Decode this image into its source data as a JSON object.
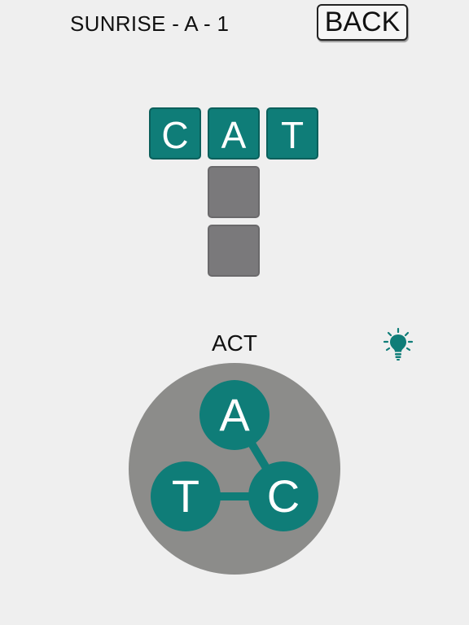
{
  "header": {
    "level_title": "SUNRISE - A - 1",
    "back_label": "BACK"
  },
  "grid": {
    "cells": [
      {
        "row": 0,
        "col": 0,
        "letter": "C",
        "state": "filled"
      },
      {
        "row": 0,
        "col": 1,
        "letter": "A",
        "state": "filled"
      },
      {
        "row": 0,
        "col": 2,
        "letter": "T",
        "state": "filled"
      },
      {
        "row": 1,
        "col": 1,
        "letter": "",
        "state": "empty"
      },
      {
        "row": 2,
        "col": 1,
        "letter": "",
        "state": "empty"
      }
    ]
  },
  "current_word": "ACT",
  "hint": {
    "icon": "lightbulb-icon"
  },
  "wheel": {
    "letters": [
      "A",
      "T",
      "C"
    ],
    "selected_path": [
      "A",
      "C",
      "T"
    ]
  },
  "colors": {
    "background": "#efefef",
    "tile": "#0f7d78",
    "empty_cell": "#7a797b",
    "wheel": "#8c8c8a",
    "text": "#111111"
  }
}
